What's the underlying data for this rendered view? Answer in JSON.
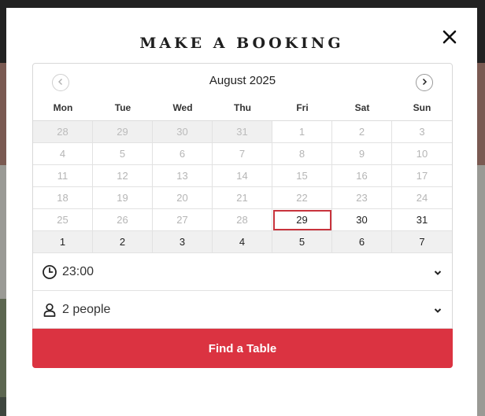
{
  "modal": {
    "title": "MAKE A BOOKING",
    "close_icon": "close-icon"
  },
  "calendar": {
    "month_label": "August 2025",
    "prev_icon": "chevron-left-icon",
    "next_icon": "chevron-right-icon",
    "weekdays": [
      "Mon",
      "Tue",
      "Wed",
      "Thu",
      "Fri",
      "Sat",
      "Sun"
    ],
    "selected_day": "29",
    "days": [
      {
        "label": "28",
        "state": "muted"
      },
      {
        "label": "29",
        "state": "muted"
      },
      {
        "label": "30",
        "state": "muted"
      },
      {
        "label": "31",
        "state": "muted"
      },
      {
        "label": "1",
        "state": "past"
      },
      {
        "label": "2",
        "state": "past"
      },
      {
        "label": "3",
        "state": "past"
      },
      {
        "label": "4",
        "state": "past"
      },
      {
        "label": "5",
        "state": "past"
      },
      {
        "label": "6",
        "state": "past"
      },
      {
        "label": "7",
        "state": "past"
      },
      {
        "label": "8",
        "state": "past"
      },
      {
        "label": "9",
        "state": "past"
      },
      {
        "label": "10",
        "state": "past"
      },
      {
        "label": "11",
        "state": "past"
      },
      {
        "label": "12",
        "state": "past"
      },
      {
        "label": "13",
        "state": "past"
      },
      {
        "label": "14",
        "state": "past"
      },
      {
        "label": "15",
        "state": "past"
      },
      {
        "label": "16",
        "state": "past"
      },
      {
        "label": "17",
        "state": "past"
      },
      {
        "label": "18",
        "state": "past"
      },
      {
        "label": "19",
        "state": "past"
      },
      {
        "label": "20",
        "state": "past"
      },
      {
        "label": "21",
        "state": "past"
      },
      {
        "label": "22",
        "state": "past"
      },
      {
        "label": "23",
        "state": "past"
      },
      {
        "label": "24",
        "state": "past"
      },
      {
        "label": "25",
        "state": "past"
      },
      {
        "label": "26",
        "state": "past"
      },
      {
        "label": "27",
        "state": "past"
      },
      {
        "label": "28",
        "state": "past"
      },
      {
        "label": "29",
        "state": "selected"
      },
      {
        "label": "30",
        "state": "avail"
      },
      {
        "label": "31",
        "state": "avail"
      },
      {
        "label": "1",
        "state": "next-month"
      },
      {
        "label": "2",
        "state": "next-month"
      },
      {
        "label": "3",
        "state": "next-month"
      },
      {
        "label": "4",
        "state": "next-month"
      },
      {
        "label": "5",
        "state": "next-month"
      },
      {
        "label": "6",
        "state": "next-month"
      },
      {
        "label": "7",
        "state": "next-month"
      }
    ]
  },
  "time_select": {
    "icon": "clock-icon",
    "value": "23:00",
    "chevron_icon": "chevron-down-icon"
  },
  "party_select": {
    "icon": "person-icon",
    "value": "2 people",
    "chevron_icon": "chevron-down-icon"
  },
  "find_button": {
    "label": "Find a Table",
    "color": "#db3341"
  },
  "colors": {
    "accent": "#db3341",
    "selected_outline": "#c8333c"
  }
}
